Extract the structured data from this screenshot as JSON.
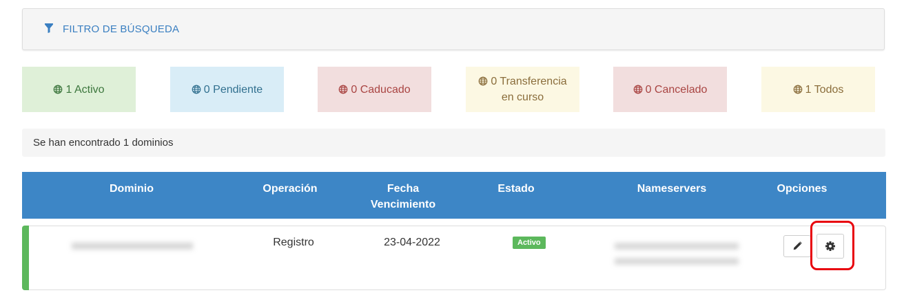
{
  "filter": {
    "title": "FILTRO DE BÚSQUEDA",
    "icon": "funnel-icon"
  },
  "status_boxes": [
    {
      "label": "1 Activo",
      "bg": "#dff0d8",
      "color": "#3c763d"
    },
    {
      "label": "0 Pendiente",
      "bg": "#d9edf7",
      "color": "#31708f"
    },
    {
      "label": "0 Caducado",
      "bg": "#f2dede",
      "color": "#a94442"
    },
    {
      "label_line1": "0 Transferencia",
      "label_line2": "en curso",
      "bg": "#fcf8e3",
      "color": "#8a6d3b"
    },
    {
      "label": "0 Cancelado",
      "bg": "#f2dede",
      "color": "#a94442"
    },
    {
      "label": "1 Todos",
      "bg": "#fcf8e3",
      "color": "#8a6d3b"
    }
  ],
  "results_text": "Se han encontrado 1 dominios",
  "table": {
    "headers": {
      "dominio": "Dominio",
      "operacion": "Operación",
      "fecha_line1": "Fecha",
      "fecha_line2": "Vencimiento",
      "estado": "Estado",
      "nameservers": "Nameservers",
      "opciones": "Opciones"
    },
    "header_bg": "#3d86c6",
    "rows": [
      {
        "dominio": "xxxxxxxxxxxxxxxxxxxxxx",
        "operacion": "Registro",
        "fecha": "23-04-2022",
        "estado": "Activo",
        "ns1": "xxxxxxxxxxxxxxxxxxxxxxxx",
        "ns2": "xxxxxxxxxxxxxxxxxxxxxxxx",
        "accent": "#5cb85c"
      }
    ]
  },
  "icons": {
    "edit": "pencil-icon",
    "settings": "gear-icon",
    "status": "globe-icon"
  }
}
